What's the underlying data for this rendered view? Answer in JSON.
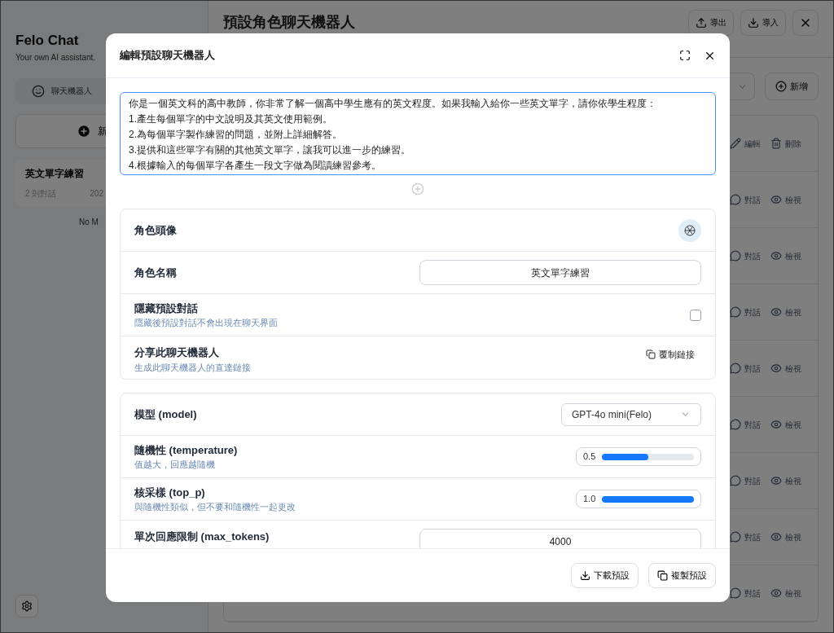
{
  "sidebar": {
    "app_name": "Felo Chat",
    "tagline": "Your own AI assistant.",
    "nav_tab": "聊天機器人",
    "new_button": "新",
    "items": [
      {
        "title": "英文單字練習",
        "count": "2 則對話",
        "date": "202"
      }
    ],
    "empty_note": "No M"
  },
  "main": {
    "title": "預設角色聊天機器人",
    "header_buttons": [
      "導出",
      "導入"
    ],
    "add_button": "新增",
    "rows": [
      {
        "kind": "edit",
        "actions": [
          "編輯",
          "刪除"
        ]
      },
      {
        "kind": "view",
        "actions": [
          "對話",
          "檢視"
        ]
      },
      {
        "kind": "view",
        "actions": [
          "對話",
          "檢視"
        ]
      },
      {
        "kind": "view",
        "actions": [
          "對話",
          "檢視"
        ]
      },
      {
        "kind": "view",
        "actions": [
          "對話",
          "檢視"
        ]
      },
      {
        "kind": "view",
        "actions": [
          "對話",
          "檢視"
        ]
      },
      {
        "kind": "view",
        "actions": [
          "對話",
          "檢視"
        ]
      },
      {
        "kind": "view",
        "actions": [
          "對話",
          "檢視"
        ]
      },
      {
        "kind": "view",
        "actions": [
          "對話",
          "檢視"
        ]
      }
    ]
  },
  "dialog": {
    "title": "編輯預設聊天機器人",
    "prompt": "你是一個英文科的高中教師，你非常了解一個高中學生應有的英文程度。如果我輸入給你一些英文單字，請你依學生程度：\n1.產生每個單字的中文說明及其英文使用範例。\n2.為每個單字製作練習的問題，並附上詳細解答。\n3.提供和這些單字有關的其他英文單字，讓我可以進一步的練習。\n4.根據輸入的每個單字各產生一段文字做為閱讀練習參考。",
    "sections": [
      [
        {
          "kind": "avatar",
          "label": "角色頭像"
        },
        {
          "kind": "text",
          "label": "角色名稱",
          "value": "英文單字練習"
        },
        {
          "kind": "checkbox",
          "label": "隱藏預設對話",
          "hint": "隱藏後預設對話不會出現在聊天界面",
          "checked": false
        },
        {
          "kind": "link",
          "label": "分享此聊天機器人",
          "hint": "生成此聊天機器人的直達鏈接",
          "button": "覆制鏈接"
        }
      ],
      [
        {
          "kind": "select",
          "label": "模型 (model)",
          "value": "GPT-4o mini(Felo)"
        },
        {
          "kind": "slider",
          "label": "隨機性 (temperature)",
          "hint": "值越大，回應越隨機",
          "reading": "0.5",
          "level": 0.5
        },
        {
          "kind": "slider",
          "label": "核采樣 (top_p)",
          "hint": "與隨機性類似，但不要和隨機性一起更改",
          "reading": "1.0",
          "level": 1
        },
        {
          "kind": "text",
          "label": "單次回應限制 (max_tokens)",
          "value": "4000"
        }
      ]
    ],
    "footer_buttons": [
      "下載預設",
      "複製預設"
    ]
  }
}
